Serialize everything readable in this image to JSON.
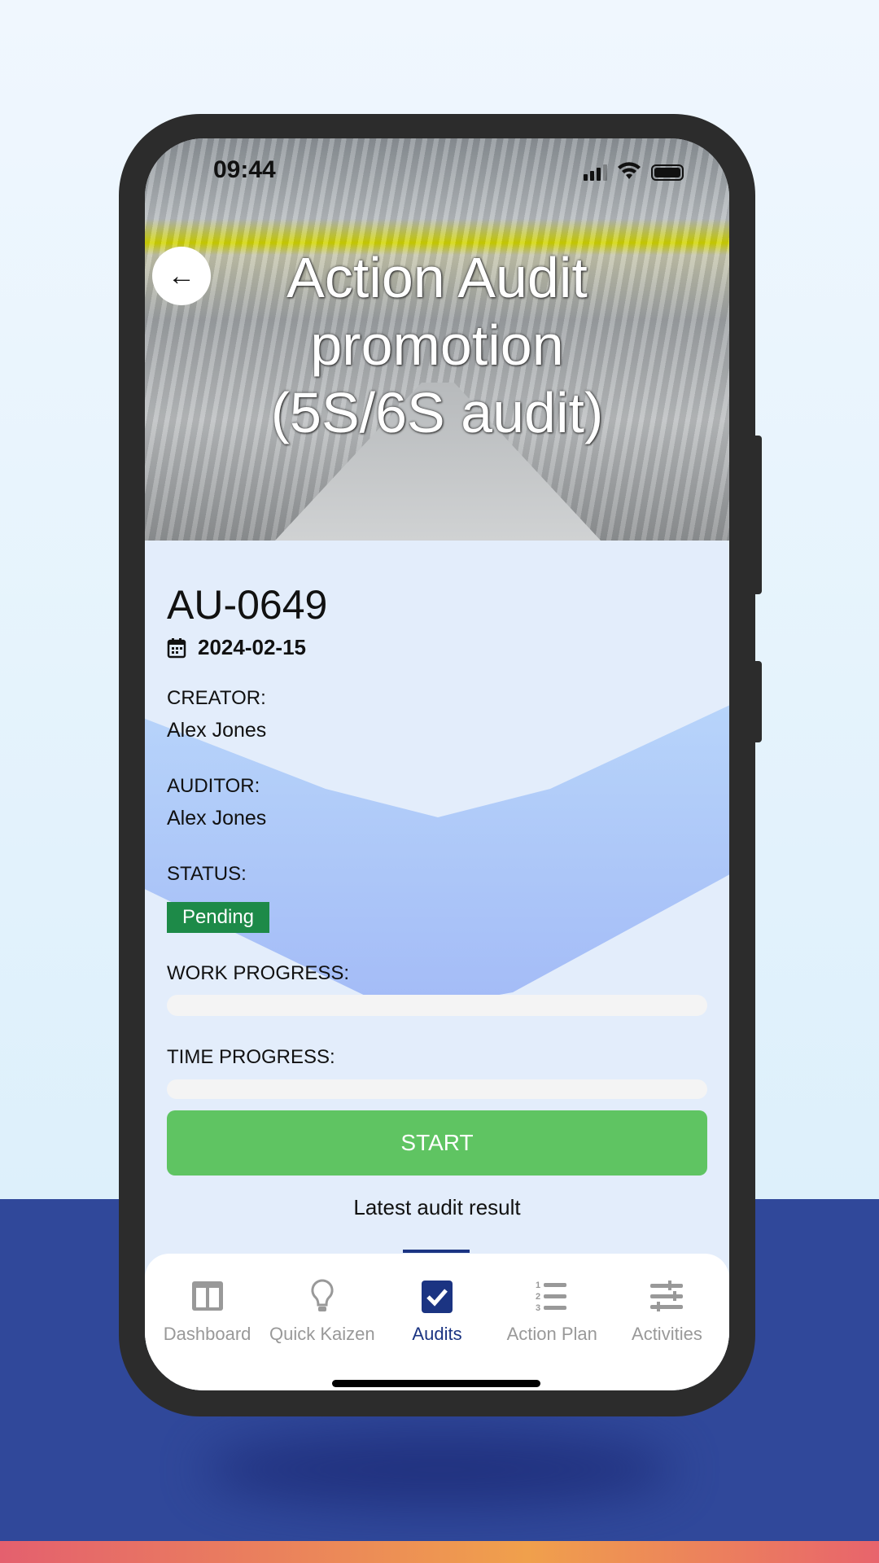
{
  "status_bar": {
    "time": "09:44"
  },
  "header": {
    "title": "Action Audit promotion (5S/6S audit)"
  },
  "audit": {
    "id": "AU-0649",
    "date": "2024-02-15",
    "creator_label": "CREATOR:",
    "creator": "Alex Jones",
    "auditor_label": "AUDITOR:",
    "auditor": "Alex Jones",
    "status_label": "STATUS:",
    "status": "Pending",
    "status_color": "#1d8a48",
    "work_progress_label": "WORK PROGRESS:",
    "work_progress": 0,
    "time_progress_label": "TIME PROGRESS:",
    "time_progress": 0,
    "start_label": "START",
    "start_color": "#5fc462",
    "latest_result_label": "Latest audit result"
  },
  "nav": {
    "items": [
      {
        "label": "Dashboard",
        "icon": "dashboard-icon"
      },
      {
        "label": "Quick Kaizen",
        "icon": "lightbulb-icon"
      },
      {
        "label": "Audits",
        "icon": "checkbox-icon",
        "active": true
      },
      {
        "label": "Action Plan",
        "icon": "numbered-list-icon"
      },
      {
        "label": "Activities",
        "icon": "sliders-icon"
      }
    ],
    "active_color": "#1b3482"
  }
}
